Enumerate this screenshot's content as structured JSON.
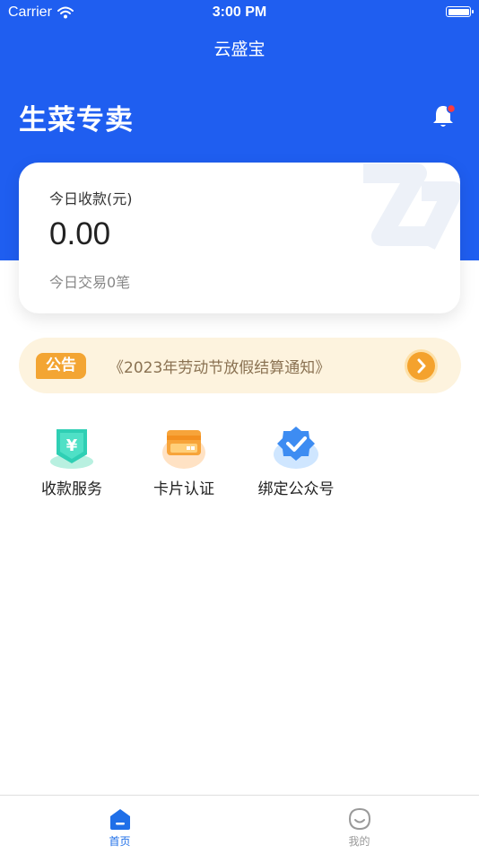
{
  "status_bar": {
    "carrier": "Carrier",
    "time": "3:00 PM"
  },
  "nav": {
    "title": "云盛宝"
  },
  "header": {
    "store_name": "生菜专卖",
    "notification_icon": "bell-icon"
  },
  "income_card": {
    "label": "今日收款(元)",
    "amount": "0.00",
    "transactions_text": "今日交易0笔"
  },
  "notice": {
    "badge": "公告",
    "text": "《2023年劳动节放假结算通知》",
    "arrow_icon": "chevron-right-icon"
  },
  "services": [
    {
      "label": "收款服务",
      "icon": "yen-shield-icon"
    },
    {
      "label": "卡片认证",
      "icon": "card-icon"
    },
    {
      "label": "绑定公众号",
      "icon": "verified-badge-icon"
    }
  ],
  "tabbar": {
    "tabs": [
      {
        "label": "首页",
        "icon": "home-icon",
        "active": true
      },
      {
        "label": "我的",
        "icon": "profile-face-icon",
        "active": false
      }
    ]
  },
  "colors": {
    "primary": "#1f5ef0",
    "notice_bg": "#fdf3de",
    "notice_accent": "#f3a533",
    "tab_active": "#1f6fe8",
    "tab_inactive": "#999999"
  }
}
